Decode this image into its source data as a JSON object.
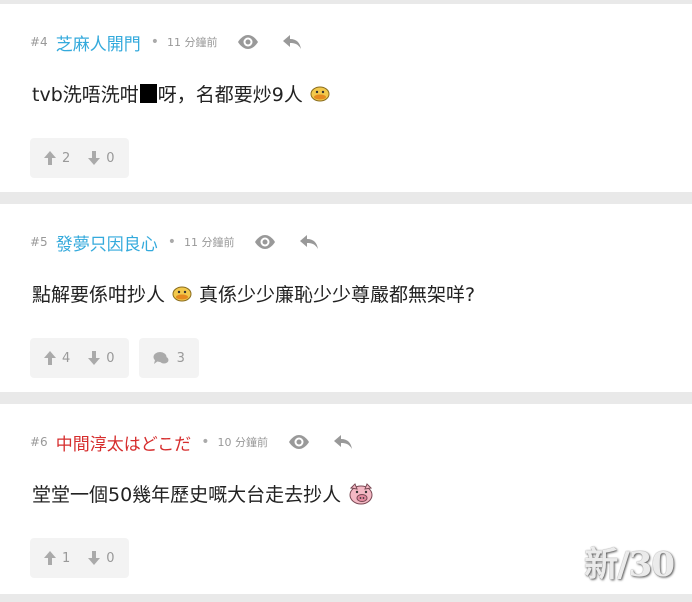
{
  "posts": [
    {
      "floor": "#4",
      "user": "芝麻人開門",
      "dot": "•",
      "time": "11 分鐘前",
      "content_a": "tvb洗唔洗咁",
      "content_b": "呀，名都要炒9人",
      "upvotes": "2",
      "downvotes": "0"
    },
    {
      "floor": "#5",
      "user": "發夢只因良心",
      "dot": "•",
      "time": "11 分鐘前",
      "content_a": "點解要係咁抄人",
      "content_b": "真係少少廉恥少少尊嚴都無架咩?",
      "upvotes": "4",
      "downvotes": "0",
      "replies": "3"
    },
    {
      "floor": "#6",
      "user": "中間淳太はどこだ",
      "dot": "•",
      "time": "10 分鐘前",
      "content_a": "堂堂一個50幾年歷史嘅大台走去抄人",
      "upvotes": "1",
      "downvotes": "0"
    }
  ],
  "watermark": "新/30",
  "colors": {
    "male_user": "#34aadc",
    "female_user": "#d62d2d",
    "page_bg": "#e9e9e9"
  },
  "icons": [
    "eye-icon",
    "reply-arrow-icon",
    "thumb-up-arrow-icon",
    "thumb-down-arrow-icon",
    "comment-bubble-icon",
    "duck-emoji-icon",
    "pig-emoji-icon"
  ]
}
